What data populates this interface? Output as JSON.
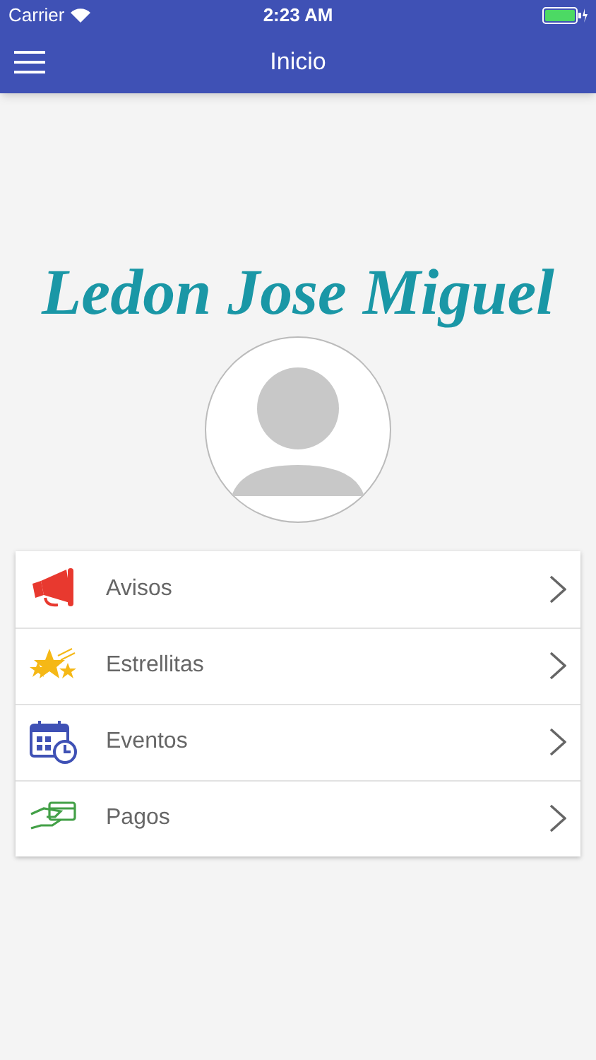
{
  "status_bar": {
    "carrier": "Carrier",
    "time": "2:23 AM"
  },
  "nav_bar": {
    "title": "Inicio"
  },
  "profile": {
    "name": "Ledon Jose Miguel"
  },
  "menu": [
    {
      "kind": "megaphone",
      "label": "Avisos"
    },
    {
      "kind": "stars",
      "label": "Estrellitas"
    },
    {
      "kind": "calendar",
      "label": "Eventos"
    },
    {
      "kind": "payment",
      "label": "Pagos"
    }
  ]
}
